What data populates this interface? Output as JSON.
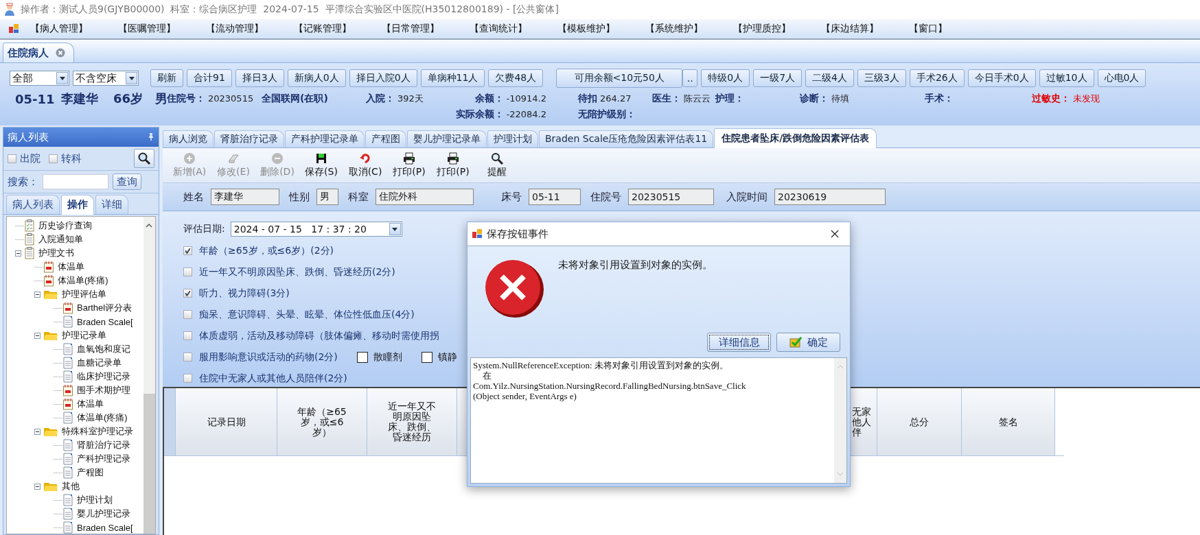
{
  "window": {
    "title": "操作者：测试人员9(GJYB00000)  科室：综合病区护理  2024-07-15  平潭综合实验区中医院(H35012800189) - [公共窗体]"
  },
  "menu": [
    "【病人管理】",
    "【医嘱管理】",
    "【流动管理】",
    "【记账管理】",
    "【日常管理】",
    "【查询统计】",
    "【模板维护】",
    "【系统维护】",
    "【护理质控】",
    "【床边结算】",
    "【窗口】"
  ],
  "main_tab": {
    "label": "住院病人"
  },
  "filters": [
    {
      "value": "全部"
    },
    {
      "value": "不含空床"
    }
  ],
  "quick_buttons": [
    {
      "label": "刷新",
      "kind": "plain"
    },
    {
      "label": "合计91",
      "kind": "plain"
    },
    {
      "label": "择日3人",
      "kind": "plain"
    },
    {
      "label": "新病人0人",
      "kind": "plain"
    },
    {
      "label": "择日入院0人",
      "kind": "plain"
    },
    {
      "label": "单病种11人",
      "kind": "plain"
    },
    {
      "label": "欠费48人",
      "kind": "plain"
    },
    {
      "label": "可用余额<10元50人",
      "kind": "split",
      "extra": ".."
    },
    {
      "label": "特级0人",
      "kind": "plain"
    },
    {
      "label": "一级7人",
      "kind": "plain"
    },
    {
      "label": "二级4人",
      "kind": "plain"
    },
    {
      "label": "三级3人",
      "kind": "plain"
    },
    {
      "label": "手术26人",
      "kind": "plain"
    },
    {
      "label": "今日手术0人",
      "kind": "plain"
    },
    {
      "label": "过敏10人",
      "kind": "plain"
    },
    {
      "label": "心电0人",
      "kind": "plain"
    }
  ],
  "patient": {
    "row1": [
      {
        "kind": "big",
        "value": "05-11"
      },
      {
        "kind": "big",
        "value": "李建华"
      },
      {
        "kind": "big",
        "value": "66岁"
      },
      {
        "kind": "big",
        "value": "男"
      },
      {
        "kind": "field",
        "label": "住院号：",
        "value": "20230515"
      },
      {
        "kind": "bold",
        "value": "全国联网(在职)"
      },
      {
        "kind": "field",
        "label": "入院：",
        "value": "392天"
      },
      {
        "kind": "field",
        "label": "余额：",
        "value": "-10914.2"
      },
      {
        "kind": "field",
        "label": "待扣",
        "value": "264.27"
      },
      {
        "kind": "field",
        "label": "医生：",
        "value": "陈云云"
      },
      {
        "kind": "field",
        "label": "护理："
      },
      {
        "kind": "field",
        "label": "诊断：",
        "value": "待填"
      },
      {
        "kind": "field",
        "label": "手术："
      },
      {
        "kind": "alert",
        "label": "过敏史：",
        "value": "未发现"
      }
    ],
    "row2": [
      {
        "kind": "field",
        "label": "实际余额：",
        "value": "-22084.2"
      },
      {
        "kind": "field",
        "label": "无陪护级别："
      }
    ]
  },
  "side_panel": {
    "title": "病人列表",
    "checks": [
      {
        "label": "出院",
        "checked": false
      },
      {
        "label": "转科",
        "checked": false
      }
    ],
    "search": {
      "label": "搜索：",
      "button": "查询"
    },
    "tabs": [
      {
        "label": "病人列表",
        "selected": false
      },
      {
        "label": "操作",
        "selected": true
      },
      {
        "label": "详细",
        "selected": false
      }
    ]
  },
  "tree": [
    {
      "label": "历史诊疗查询",
      "kind": "checklist"
    },
    {
      "label": "入院通知单",
      "kind": "clipboard"
    },
    {
      "label": "护理文书",
      "kind": "clipboard",
      "expanded": true,
      "children": [
        {
          "label": "体温单",
          "kind": "calendar"
        },
        {
          "label": "体温单(疼痛)",
          "kind": "calendar"
        },
        {
          "label": "护理评估单",
          "kind": "folder",
          "expanded": true,
          "children": [
            {
              "label": "Barthel评分表",
              "kind": "calendar"
            },
            {
              "label": "Braden Scale[",
              "kind": "page"
            }
          ]
        },
        {
          "label": "护理记录单",
          "kind": "folder",
          "expanded": true,
          "children": [
            {
              "label": "血氧饱和度记",
              "kind": "page"
            },
            {
              "label": "血糖记录单",
              "kind": "page"
            },
            {
              "label": "临床护理记录",
              "kind": "page"
            },
            {
              "label": "围手术期护理",
              "kind": "calendar"
            },
            {
              "label": "体温单",
              "kind": "calendar"
            },
            {
              "label": "体温单(疼痛)",
              "kind": "page"
            }
          ]
        },
        {
          "label": "特殊科室护理记录",
          "kind": "folder",
          "expanded": true,
          "children": [
            {
              "label": "肾脏治疗记录",
              "kind": "page"
            },
            {
              "label": "产科护理记录",
              "kind": "page"
            },
            {
              "label": "产程图",
              "kind": "page"
            }
          ]
        },
        {
          "label": "其他",
          "kind": "folder",
          "expanded": true,
          "children": [
            {
              "label": "护理计划",
              "kind": "page"
            },
            {
              "label": "婴儿护理记录",
              "kind": "page"
            },
            {
              "label": "Braden Scale[",
              "kind": "page"
            }
          ]
        }
      ]
    }
  ],
  "doc_tabs": [
    {
      "label": "病人浏览",
      "selected": false
    },
    {
      "label": "肾脏治疗记录",
      "selected": false
    },
    {
      "label": "产科护理记录单",
      "selected": false
    },
    {
      "label": "产程图",
      "selected": false
    },
    {
      "label": "婴儿护理记录单",
      "selected": false
    },
    {
      "label": "护理计划",
      "selected": false
    },
    {
      "label": "Braden Scale压疮危险因素评估表11",
      "selected": false
    },
    {
      "label": "住院患者坠床/跌倒危险因素评估表",
      "selected": true
    }
  ],
  "doc_toolbar": [
    {
      "label": "新增(A)",
      "kind": "add",
      "disabled": true
    },
    {
      "label": "修改(E)",
      "kind": "edit",
      "disabled": true
    },
    {
      "label": "删除(D)",
      "kind": "delete",
      "disabled": true
    },
    {
      "label": "保存(S)",
      "kind": "save",
      "disabled": false
    },
    {
      "label": "取消(C)",
      "kind": "undo",
      "disabled": false
    },
    {
      "label": "打印(P)",
      "kind": "print",
      "disabled": false
    },
    {
      "label": "打印(P)",
      "kind": "print",
      "disabled": false
    },
    {
      "label": "提醒",
      "kind": "find",
      "disabled": false
    }
  ],
  "info_fields": [
    {
      "label": "姓名",
      "value": "李建华"
    },
    {
      "label": "性别",
      "value": "男"
    },
    {
      "label": "科室",
      "value": "住院外科"
    },
    {
      "label": "床号",
      "value": "05-11"
    },
    {
      "label": "住院号",
      "value": "20230515"
    },
    {
      "label": "入院时间",
      "value": "20230619"
    }
  ],
  "evaluation": {
    "date_label": "评估日期:",
    "date_value": "2024 - 07 - 15   17 : 37 : 20",
    "items": [
      {
        "label": "年龄（≥65岁，或≤6岁）(2分)",
        "checked": true
      },
      {
        "label": "近一年又不明原因坠床、跌倒、昏迷经历(2分)",
        "checked": false
      },
      {
        "label": "听力、视力障碍(3分)",
        "checked": true
      },
      {
        "label": "痴呆、意识障碍、头晕、眩晕、体位性低血压(4分)",
        "checked": false
      },
      {
        "label": "体质虚弱，活动及移动障碍（肢体偏瘫、移动时需使用拐",
        "checked": false
      },
      {
        "label": "服用影响意识或活动的药物(2分)",
        "checked": false,
        "options": [
          {
            "label": "散瞳剂",
            "checked": false
          },
          {
            "label": "镇静",
            "checked": false
          }
        ]
      },
      {
        "label": "住院中无家人或其他人员陪伴(2分)",
        "checked": false
      }
    ]
  },
  "table": {
    "columns": [
      {
        "label": "记录日期",
        "kind": "date"
      },
      {
        "label": "年龄（≥65岁，或≤6岁）",
        "kind": "narrow"
      },
      {
        "label": "近一年又不明原因坠床、跌倒、昏迷经历",
        "kind": "narrow"
      },
      {
        "label": "无家他人伴",
        "kind": "partial"
      },
      {
        "label": "总分",
        "kind": "sum"
      },
      {
        "label": "签名",
        "kind": "sign"
      }
    ]
  },
  "dialog": {
    "title": "保存按钮事件",
    "message": "未将对象引用设置到对象的实例。",
    "buttons": [
      {
        "label": "详细信息",
        "kind": "details"
      },
      {
        "label": "确定",
        "kind": "ok"
      }
    ],
    "details": [
      {
        "text": "System.NullReferenceException: 未将对象引用设置到对象的实例。",
        "kind": "line"
      },
      {
        "text": "在",
        "kind": "indent"
      },
      {
        "text": "Com.Yilz.NursingStation.NursingRecord.FallingBedNursing.btnSave_Click",
        "kind": "line"
      },
      {
        "text": "(Object sender, EventArgs e)",
        "kind": "line"
      }
    ]
  }
}
